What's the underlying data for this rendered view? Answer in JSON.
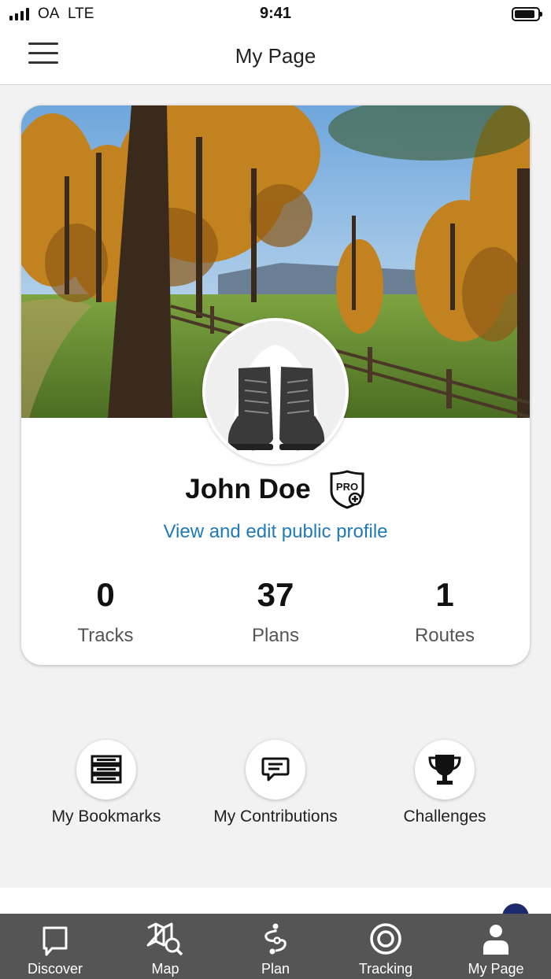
{
  "status_bar": {
    "carrier": "OA",
    "network": "LTE",
    "time": "9:41"
  },
  "header": {
    "title": "My Page"
  },
  "profile": {
    "name": "John Doe",
    "badge": "PRO",
    "link": "View and edit public profile",
    "stats": [
      {
        "value": "0",
        "label": "Tracks"
      },
      {
        "value": "37",
        "label": "Plans"
      },
      {
        "value": "1",
        "label": "Routes"
      }
    ]
  },
  "quick_links": [
    {
      "label": "My Bookmarks",
      "icon": "bookmarks-icon"
    },
    {
      "label": "My Contributions",
      "icon": "contributions-icon"
    },
    {
      "label": "Challenges",
      "icon": "trophy-icon"
    }
  ],
  "tabs": [
    {
      "label": "Discover",
      "icon": "discover-icon"
    },
    {
      "label": "Map",
      "icon": "map-icon"
    },
    {
      "label": "Plan",
      "icon": "plan-icon"
    },
    {
      "label": "Tracking",
      "icon": "tracking-icon"
    },
    {
      "label": "My Page",
      "icon": "profile-icon"
    }
  ],
  "colors": {
    "accent": "#1f7ab8",
    "tabbar": "#555555",
    "background": "#f2f2f2"
  }
}
